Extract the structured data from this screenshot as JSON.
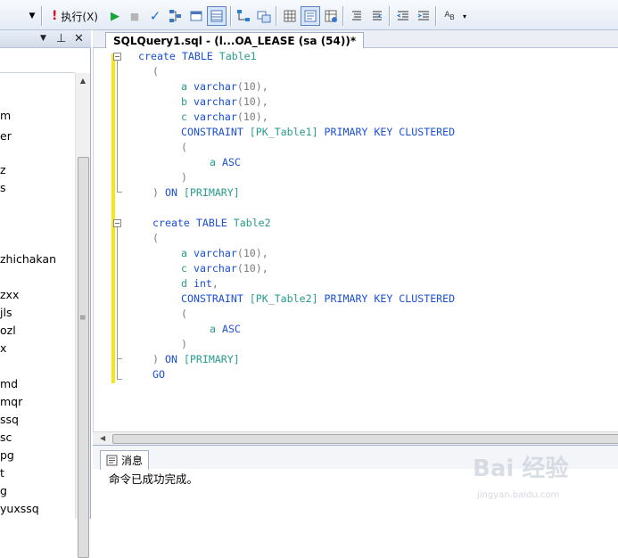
{
  "toolbar": {
    "execute_label": "执行(X)",
    "execute_icon": "exclamation-icon",
    "icons": [
      "dropdown-icon",
      "execute-icon",
      "debug-play-icon",
      "stop-icon",
      "parse-check-icon",
      "display-plan-icon",
      "query-designer-icon",
      "results-to-icon",
      "include-plan-icon",
      "client-stats-icon",
      "results-grid-icon",
      "results-text-icon",
      "results-file-icon",
      "comment-icon",
      "uncomment-icon",
      "decrease-indent-icon",
      "increase-indent-icon",
      "specify-values-icon",
      "toolbar-options-icon"
    ]
  },
  "explorer": {
    "header_buttons": [
      "dropdown",
      "pin",
      "close"
    ],
    "items": [
      "m",
      "er",
      "z",
      "s",
      "zhichakan",
      "zxx",
      "jls",
      "ozl",
      "x",
      "md",
      "mqr",
      "ssq",
      "sc",
      "pg",
      "t",
      "g",
      "yuxssq"
    ]
  },
  "editor": {
    "tab_title": "SQLQuery1.sql - (l...OA_LEASE (sa (54))*",
    "lines": [
      [
        {
          "t": "create ",
          "c": "kw"
        },
        {
          "t": "TABLE ",
          "c": "kw"
        },
        {
          "t": "Table1",
          "c": "obj"
        }
      ],
      [
        {
          "t": "(",
          "c": "punc"
        }
      ],
      [
        {
          "t": "a ",
          "c": "obj"
        },
        {
          "t": "varchar",
          "c": "kw"
        },
        {
          "t": "(10),",
          "c": "punc"
        }
      ],
      [
        {
          "t": "b ",
          "c": "obj"
        },
        {
          "t": "varchar",
          "c": "kw"
        },
        {
          "t": "(10),",
          "c": "punc"
        }
      ],
      [
        {
          "t": "c ",
          "c": "obj"
        },
        {
          "t": "varchar",
          "c": "kw"
        },
        {
          "t": "(10),",
          "c": "punc"
        }
      ],
      [
        {
          "t": "CONSTRAINT ",
          "c": "kw"
        },
        {
          "t": "[PK_Table1] ",
          "c": "obj"
        },
        {
          "t": "PRIMARY KEY CLUSTERED",
          "c": "kw"
        }
      ],
      [
        {
          "t": "(",
          "c": "punc"
        }
      ],
      [
        {
          "t": "a ",
          "c": "obj"
        },
        {
          "t": "ASC",
          "c": "kw"
        }
      ],
      [
        {
          "t": ")",
          "c": "punc"
        }
      ],
      [
        {
          "t": ") ",
          "c": "punc"
        },
        {
          "t": "ON ",
          "c": "kw"
        },
        {
          "t": "[PRIMARY]",
          "c": "obj"
        }
      ],
      [],
      [
        {
          "t": "create ",
          "c": "kw"
        },
        {
          "t": "TABLE ",
          "c": "kw"
        },
        {
          "t": "Table2",
          "c": "obj"
        }
      ],
      [
        {
          "t": "(",
          "c": "punc"
        }
      ],
      [
        {
          "t": "a ",
          "c": "obj"
        },
        {
          "t": "varchar",
          "c": "kw"
        },
        {
          "t": "(10),",
          "c": "punc"
        }
      ],
      [
        {
          "t": "c ",
          "c": "obj"
        },
        {
          "t": "varchar",
          "c": "kw"
        },
        {
          "t": "(10),",
          "c": "punc"
        }
      ],
      [
        {
          "t": "d ",
          "c": "obj"
        },
        {
          "t": "int",
          "c": "kw"
        },
        {
          "t": ",",
          "c": "punc"
        }
      ],
      [
        {
          "t": "CONSTRAINT ",
          "c": "kw"
        },
        {
          "t": "[PK_Table2] ",
          "c": "obj"
        },
        {
          "t": "PRIMARY KEY CLUSTERED",
          "c": "kw"
        }
      ],
      [
        {
          "t": "(",
          "c": "punc"
        }
      ],
      [
        {
          "t": "a ",
          "c": "obj"
        },
        {
          "t": "ASC",
          "c": "kw"
        }
      ],
      [
        {
          "t": ")",
          "c": "punc"
        }
      ],
      [
        {
          "t": ") ",
          "c": "punc"
        },
        {
          "t": "ON ",
          "c": "kw"
        },
        {
          "t": "[PRIMARY]",
          "c": "obj"
        }
      ],
      [
        {
          "t": "GO",
          "c": "kw"
        }
      ]
    ]
  },
  "results": {
    "tab_label": "消息",
    "message": "命令已成功完成。"
  },
  "watermark": {
    "text": "Bai 经验",
    "sub": "jingyan.baidu.com"
  },
  "colors": {
    "keyword": "#1a4fd6",
    "identifier": "#2a9b8c",
    "punctuation": "#7d7d7d",
    "gutter_changed": "#f5e51b"
  }
}
